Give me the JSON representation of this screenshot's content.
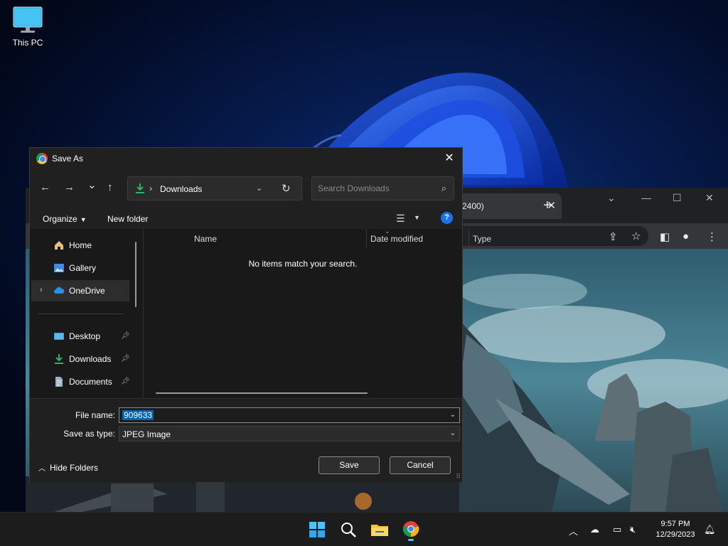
{
  "desktop": {
    "icons": [
      {
        "label": "This PC",
        "icon": "monitor-icon"
      }
    ]
  },
  "browser": {
    "tab_title": "2400)",
    "tab_close": "✕",
    "new_tab": "+"
  },
  "dialog": {
    "title": "Save As",
    "close": "✕",
    "nav": {
      "back": "←",
      "forward": "→",
      "recent": "⌄",
      "up": "↑"
    },
    "address": {
      "chevron": "›",
      "location": "Downloads",
      "dropdown": "⌄",
      "refresh": "↻"
    },
    "search": {
      "placeholder": "Search Downloads",
      "icon": "⌕"
    },
    "commands": {
      "organize": "Organize",
      "new_folder": "New folder",
      "help": "?"
    },
    "nav_pane": {
      "items": [
        {
          "label": "Home",
          "icon": "home-icon"
        },
        {
          "label": "Gallery",
          "icon": "gallery-icon"
        },
        {
          "label": "OneDrive",
          "icon": "cloud-icon",
          "selected": true
        },
        {
          "label": "Desktop",
          "icon": "desktop-folder-icon",
          "pinned": true
        },
        {
          "label": "Downloads",
          "icon": "download-icon",
          "pinned": true
        },
        {
          "label": "Documents",
          "icon": "document-icon",
          "pinned": true
        }
      ]
    },
    "columns": [
      "Name",
      "Date modified",
      "Type"
    ],
    "empty_message": "No items match your search.",
    "file_name_label": "File name:",
    "file_name_value": "909633",
    "save_type_label": "Save as type:",
    "save_type_value": "JPEG Image",
    "hide_folders": "Hide Folders",
    "save_label": "Save",
    "cancel_label": "Cancel"
  },
  "taskbar": {
    "clock_time": "9:57 PM",
    "clock_date": "12/29/2023"
  },
  "colors": {
    "accent": "#0063b1",
    "help_blue": "#1a73e8",
    "dialog_bg": "#202020"
  }
}
